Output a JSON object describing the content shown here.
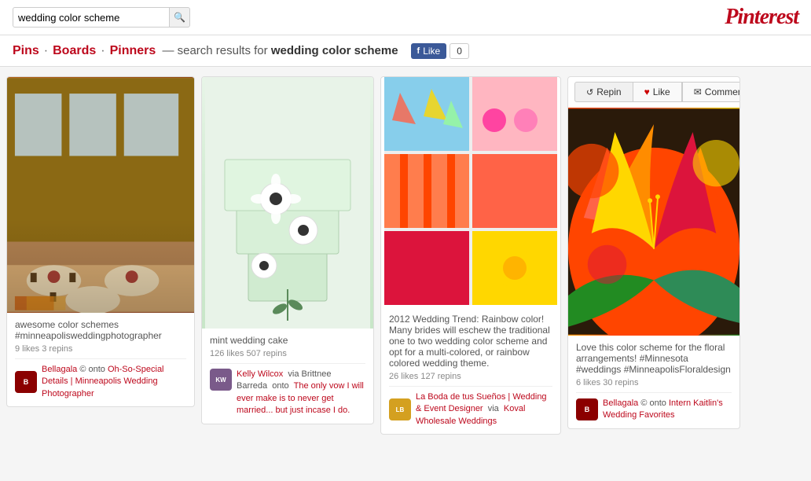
{
  "header": {
    "search_placeholder": "wedding color scheme",
    "search_value": "wedding color scheme",
    "logo": "Pinterest",
    "search_icon": "🔍"
  },
  "nav": {
    "pins_label": "Pins",
    "boards_label": "Boards",
    "pinners_label": "Pinners",
    "search_prefix": "— search results for",
    "search_query": "wedding color scheme",
    "like_label": "Like",
    "like_count": "0"
  },
  "pins": [
    {
      "id": "pin1",
      "title": "awesome color schemes #minneapolisweddingphotographer",
      "stats": "9 likes   3 repins",
      "avatar_label": "B",
      "user": "Bellagala",
      "user_suffix": "© onto",
      "board_link": "Oh-So-Special Details | Minneapolis Wedding Photographer"
    },
    {
      "id": "pin2",
      "title": "mint wedding cake",
      "stats": "126 likes   507 repins",
      "avatar_label": "KW",
      "user": "Kelly Wilcox",
      "user_via": "via Brittnee Barreda",
      "user_suffix": "onto",
      "board_link": "The only vow I will ever make is to never get married... but just incase I do."
    },
    {
      "id": "pin3",
      "title": "2012 Wedding Trend: Rainbow color! Many brides will eschew the traditional one to two wedding color scheme and opt for a multi-colored, or rainbow colored wedding theme.",
      "stats": "26 likes   127 repins",
      "avatar_label": "LB",
      "user": "La Boda de tus Sueños | Wedding & Event Designer",
      "user_via": "via",
      "board_link": "Koval Wholesale Weddings"
    },
    {
      "id": "pin4",
      "title": "Love this color scheme for the floral arrangements! #Minnesota #weddings #MinneapolisFloraldesign",
      "stats": "6 likes   30 repins",
      "avatar_label": "B",
      "user": "Bellagala",
      "user_suffix": "© onto",
      "board_link": "Intern Kaitlin's Wedding Favorites",
      "action_repin": "Repin",
      "action_like": "Like",
      "action_comment": "Comment"
    }
  ]
}
